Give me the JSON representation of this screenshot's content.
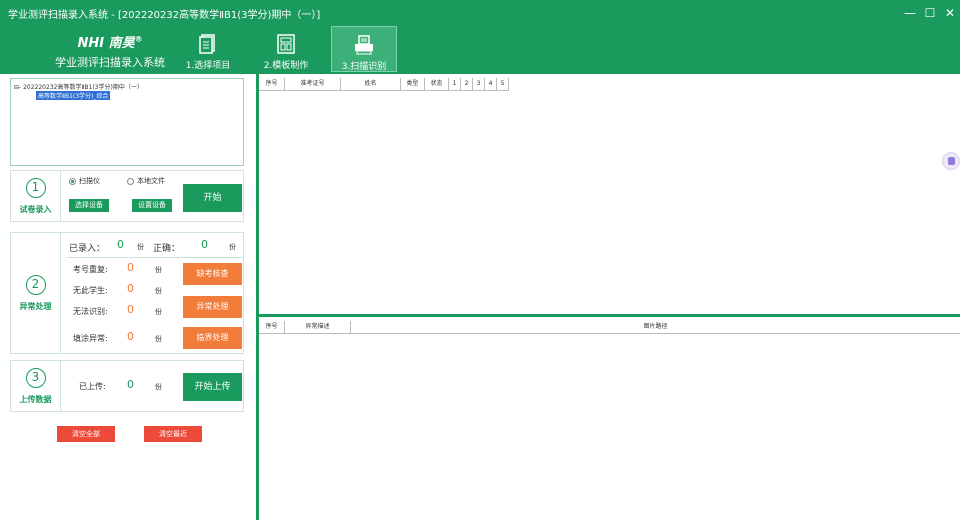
{
  "window": {
    "title": "学业测评扫描录入系统 - [202220232高等数学ⅡB1(3学分)期中（一）]",
    "min": "—",
    "max": "☐",
    "close": "✕"
  },
  "header": {
    "brand": "NHI 南昊",
    "brand_mark": "®",
    "system_name": "学业测评扫描录入系统",
    "tabs": [
      {
        "label": "1.选择项目",
        "icon": "document-icon"
      },
      {
        "label": "2.模板制作",
        "icon": "template-icon"
      },
      {
        "label": "3.扫描识别",
        "icon": "scanner-icon",
        "active": true
      }
    ]
  },
  "tree": {
    "root": "⊟- 202220232高等数学ⅡB1(3学分)期中（一）",
    "child": "高等数学ⅡB1(3学分)_综合"
  },
  "step1": {
    "num": "1",
    "label": "试卷录入",
    "opt_scanner": "扫描仪",
    "opt_local": "本地文件",
    "select_device": "选择设备",
    "set_device": "设置设备",
    "start": "开始"
  },
  "step2": {
    "num": "2",
    "label": "异常处理",
    "entered_label": "已录入：",
    "entered": "0",
    "unit": "份",
    "correct_label": "正确：",
    "correct": "0",
    "rows": [
      {
        "label": "考号重复:",
        "value": "0",
        "unit": "份"
      },
      {
        "label": "无此学生:",
        "value": "0",
        "unit": "份"
      },
      {
        "label": "无法识别:",
        "value": "0",
        "unit": "份"
      },
      {
        "label": "填涂异常:",
        "value": "0",
        "unit": "份"
      }
    ],
    "buttons": [
      "缺考核查",
      "异常处理",
      "临界处理"
    ]
  },
  "step3": {
    "num": "3",
    "label": "上传数据",
    "uploaded_label": "已上传:",
    "uploaded": "0",
    "unit": "份",
    "upload": "开始上传"
  },
  "clear_all": "清空全部",
  "clear_recent": "清空最近",
  "top_table": {
    "columns": [
      "序号",
      "准考证号",
      "姓名",
      "类型",
      "状态",
      "1",
      "2",
      "3",
      "4",
      "5"
    ]
  },
  "bottom_table": {
    "columns": [
      "序号",
      "异常描述",
      "图片路径"
    ]
  }
}
